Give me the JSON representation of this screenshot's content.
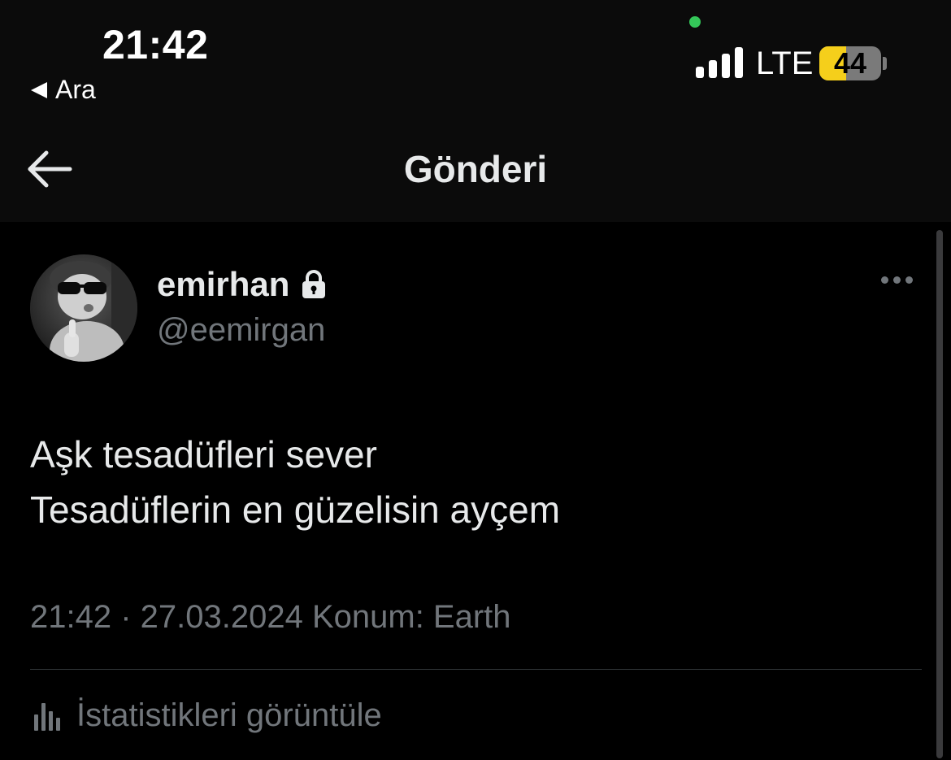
{
  "status_bar": {
    "time": "21:42",
    "back_app_label": "Ara",
    "network": "LTE",
    "battery_level": "44",
    "battery_fraction": 0.44,
    "icons": [
      "signal-icon",
      "battery-icon",
      "camera-indicator-icon"
    ]
  },
  "nav": {
    "title": "Gönderi",
    "back_icon": "arrow-left-icon"
  },
  "post": {
    "author": {
      "display_name": "emirhan",
      "handle": "@eemirgan",
      "protected_icon": "lock-icon",
      "avatar_icon": "avatar"
    },
    "more_icon": "more-dots-icon",
    "text_lines": [
      "Aşk tesadüfleri sever",
      "Tesadüflerin en güzelisin ayçem"
    ],
    "meta": "21:42 · 27.03.2024 Konum: Earth",
    "stats_label": "İstatistikleri görüntüle",
    "stats_icon": "analytics-icon"
  },
  "colors": {
    "background": "#000000",
    "header_bg": "#0b0b0b",
    "text_primary": "#e7e9ea",
    "text_secondary": "#71767b",
    "divider": "#2f3336",
    "battery_yellow": "#f5cf1b",
    "indicator_green": "#34c759"
  }
}
